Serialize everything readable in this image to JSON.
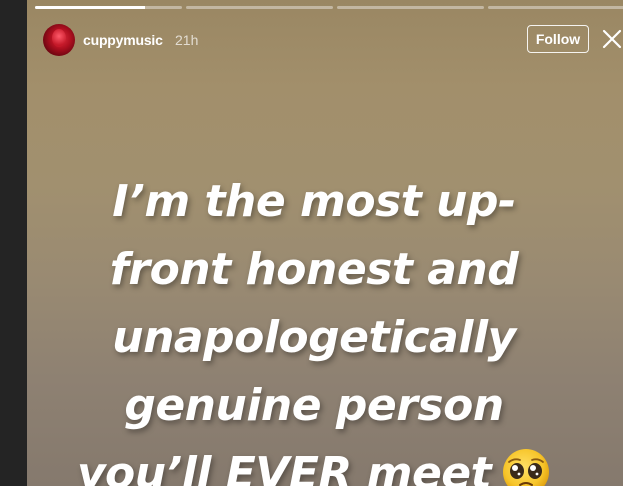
{
  "story": {
    "username": "cuppymusic",
    "timestamp": "21h",
    "follow_label": "Follow",
    "progress_segments": [
      {
        "state": "active",
        "fill": 0.75
      },
      {
        "state": "pending",
        "fill": 0
      },
      {
        "state": "pending",
        "fill": 0
      },
      {
        "state": "pending",
        "fill": 0
      }
    ],
    "text_lines": [
      "I’m the most up-",
      "front honest and",
      "unapologetically",
      "genuine person",
      "you’ll EVER meet"
    ],
    "emoji": "pleading-face-icon",
    "background_colors": [
      "#9a8763",
      "#85796d"
    ]
  },
  "icons": {
    "close": "close-icon"
  }
}
